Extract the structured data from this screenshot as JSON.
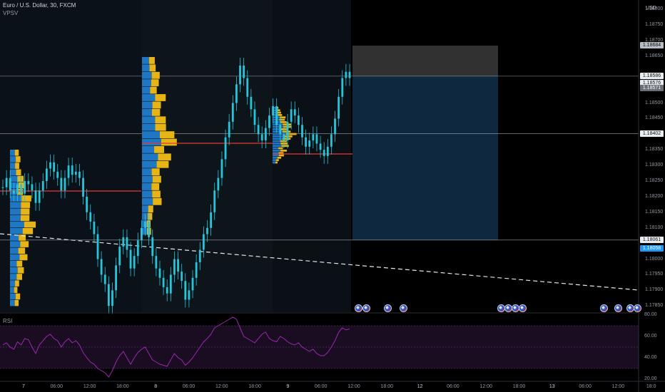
{
  "symbol": "Euro / U.S. Dollar, 30, FXCM",
  "indicator": "VPSV",
  "rsi_label": "RSI",
  "currency": "USD",
  "price_axis": [
    "1.18800",
    "1.18750",
    "1.18700",
    "1.18650",
    "1.18550",
    "1.18500",
    "1.18450",
    "1.18350",
    "1.18300",
    "1.18250",
    "1.18200",
    "1.18150",
    "1.18100",
    "1.18000",
    "1.17950",
    "1.17900",
    "1.17850"
  ],
  "price_tags": [
    {
      "label": "1.18684",
      "style": "gray"
    },
    {
      "label": "1.18586",
      "style": "white"
    },
    {
      "label": "1.18576",
      "style": "white"
    },
    {
      "label": "1.18571",
      "style": "dark"
    },
    {
      "label": "1.18402",
      "style": "white"
    },
    {
      "label": "1.18061",
      "style": "white"
    },
    {
      "label": "1.18058",
      "style": "blue"
    }
  ],
  "rsi_axis": [
    "80.00",
    "60.00",
    "40.00",
    "20.00"
  ],
  "time_axis": [
    "7",
    "06:00",
    "12:00",
    "18:00",
    "8",
    "06:00",
    "12:00",
    "18:00",
    "9",
    "06:00",
    "12:00",
    "18:00",
    "12",
    "06:00",
    "12:00",
    "18:00",
    "13",
    "06:00",
    "12:00",
    "18:0"
  ],
  "chart_data": {
    "type": "candlestick",
    "price_range": [
      1.1783,
      1.1883
    ],
    "rsi_range": [
      20,
      80
    ],
    "colors": {
      "up": "#26c6da",
      "down": "#26c6da",
      "dev_high": "#e7b416",
      "dev_low": "#1f77c4",
      "poc": "#e53935"
    },
    "horizontal_levels": [
      1.18586,
      1.18402,
      1.18061
    ],
    "candles": [
      1.1823,
      1.1826,
      1.1822,
      1.1821,
      1.1824,
      1.1821,
      1.1825,
      1.1824,
      1.1822,
      1.1818,
      1.1822,
      1.1825,
      1.1829,
      1.1831,
      1.1828,
      1.1826,
      1.1822,
      1.1826,
      1.183,
      1.1827,
      1.1828,
      1.1826,
      1.182,
      1.1815,
      1.1812,
      1.1808,
      1.18,
      1.1795,
      1.1792,
      1.1785,
      1.179,
      1.1798,
      1.1804,
      1.1807,
      1.1803,
      1.1797,
      1.1801,
      1.1806,
      1.181,
      1.1812,
      1.1807,
      1.1801,
      1.1797,
      1.1794,
      1.1791,
      1.1789,
      1.1795,
      1.18,
      1.1796,
      1.1793,
      1.1787,
      1.179,
      1.1794,
      1.1799,
      1.1803,
      1.1808,
      1.181,
      1.1815,
      1.1822,
      1.1826,
      1.1832,
      1.1839,
      1.1844,
      1.185,
      1.1856,
      1.1862,
      1.1858,
      1.1852,
      1.1848,
      1.1843,
      1.184,
      1.1838,
      1.1842,
      1.1846,
      1.1849,
      1.1843,
      1.184,
      1.1838,
      1.1844,
      1.1848,
      1.1846,
      1.1843,
      1.1839,
      1.1836,
      1.1838,
      1.184,
      1.1837,
      1.1835,
      1.1833,
      1.1836,
      1.184,
      1.1845,
      1.1852,
      1.1858,
      1.186,
      1.1858
    ],
    "rsi": [
      52,
      54,
      50,
      48,
      55,
      52,
      58,
      57,
      50,
      44,
      52,
      56,
      60,
      62,
      58,
      56,
      50,
      55,
      58,
      54,
      56,
      52,
      45,
      40,
      36,
      34,
      30,
      28,
      26,
      22,
      28,
      36,
      42,
      46,
      40,
      34,
      40,
      45,
      48,
      50,
      44,
      38,
      36,
      34,
      33,
      32,
      38,
      44,
      40,
      38,
      33,
      36,
      40,
      45,
      50,
      55,
      58,
      62,
      68,
      70,
      72,
      74,
      76,
      78,
      76,
      68,
      60,
      58,
      56,
      54,
      58,
      62,
      64,
      58,
      56,
      55,
      60,
      58,
      55,
      53,
      52,
      54,
      50,
      48,
      46,
      48,
      44,
      42,
      42,
      45,
      50,
      56,
      64,
      68,
      66,
      67
    ],
    "trade_box": {
      "entry": 1.18586,
      "target": 1.18684,
      "stop": 1.18061
    }
  }
}
